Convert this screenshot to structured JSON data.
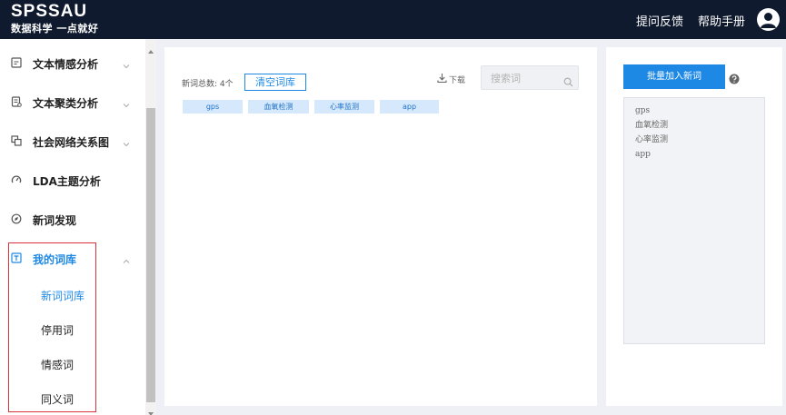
{
  "header": {
    "logo_title": "SPSSAU",
    "logo_subtitle": "数据科学 一点就好",
    "links": {
      "feedback": "提问反馈",
      "help": "帮助手册"
    },
    "avatar_icon": "user-avatar-icon"
  },
  "sidebar": {
    "items": [
      {
        "label": "文本情感分析",
        "icon": "sentiment-doc-icon",
        "expandable": true
      },
      {
        "label": "文本聚类分析",
        "icon": "cluster-doc-icon",
        "expandable": true
      },
      {
        "label": "社会网络关系图",
        "icon": "network-icon",
        "expandable": true
      },
      {
        "label": "LDA主题分析",
        "icon": "gauge-icon",
        "expandable": false
      },
      {
        "label": "新词发现",
        "icon": "compass-icon",
        "expandable": false
      },
      {
        "label": "我的词库",
        "icon": "lexicon-icon",
        "expandable": true,
        "expanded": true,
        "active": true
      }
    ],
    "sub_items": [
      {
        "label": "新词词库",
        "active": true
      },
      {
        "label": "停用词",
        "active": false
      },
      {
        "label": "情感词",
        "active": false
      },
      {
        "label": "同义词",
        "active": false
      }
    ],
    "highlight_color": "#d9323a"
  },
  "main": {
    "count_label": "新词总数: 4个",
    "clear_button": "清空词库",
    "download_label": "下载",
    "search_placeholder": "搜索词",
    "tags": [
      "gps",
      "血氧检测",
      "心率监测",
      "app"
    ]
  },
  "right_panel": {
    "batch_button": "批量加入新词",
    "textarea_value": "gps\n血氧检测\n心率监测\napp"
  },
  "colors": {
    "header_bg": "#0f1a2e",
    "accent": "#1e88e5",
    "tag_bg": "#d6e8fb",
    "page_bg": "#eef0f5"
  }
}
